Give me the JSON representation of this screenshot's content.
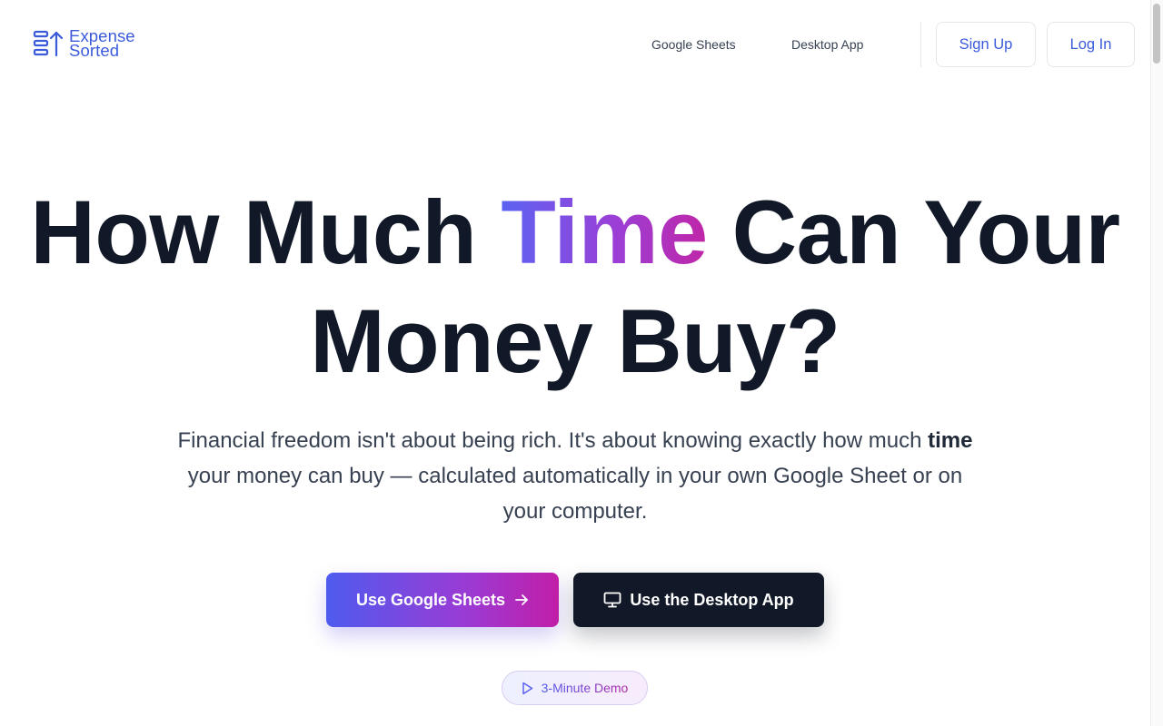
{
  "brand": {
    "line1": "Expense",
    "line2": "Sorted",
    "color": "#3b5bdb",
    "icon": "expense-sorted-logo-icon"
  },
  "nav": {
    "links": [
      {
        "label": "Google Sheets"
      },
      {
        "label": "Desktop App"
      }
    ],
    "signup_label": "Sign Up",
    "login_label": "Log In"
  },
  "hero": {
    "title_before": "How Much ",
    "title_highlight": "Time",
    "title_after": " Can Your Money Buy?",
    "subtitle_part1": "Financial freedom isn't about being rich. It's about knowing exactly how much ",
    "subtitle_bold": "time",
    "subtitle_part2": " your money can buy — calculated automatically in your own Google Sheet or on your computer.",
    "cta_primary": "Use Google Sheets",
    "cta_secondary": "Use the Desktop App",
    "demo_label": "3-Minute Demo"
  },
  "colors": {
    "accent": "#3b5bdb",
    "gradient_start": "#4f5bef",
    "gradient_end": "#c21ea8",
    "dark": "#111827"
  },
  "icons": {
    "arrow": "arrow-right-icon",
    "monitor": "monitor-icon",
    "play": "play-icon"
  }
}
